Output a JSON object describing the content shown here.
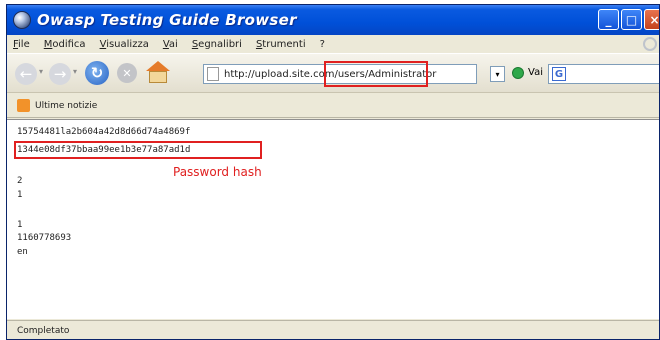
{
  "window": {
    "title": "Owasp Testing Guide Browser"
  },
  "window_buttons": {
    "minimize": "_",
    "maximize": "□",
    "close": "×"
  },
  "menu": [
    "File",
    "Modifica",
    "Visualizza",
    "Vai",
    "Segnalibri",
    "Strumenti",
    "?"
  ],
  "nav": {
    "back_glyph": "←",
    "forward_glyph": "→",
    "reload_glyph": "↻",
    "stop_glyph": "✕",
    "dropdown_glyph": "▾",
    "url": "http://upload.site.com/users/Administrator",
    "go_label": "Vai",
    "search_engine_glyph": "G"
  },
  "icons": {
    "back": "back-arrow-icon",
    "forward": "forward-arrow-icon",
    "reload": "reload-icon",
    "stop": "stop-icon",
    "home": "home-icon",
    "page": "page-icon",
    "go": "go-icon",
    "search_engine": "google-icon",
    "rss": "rss-icon",
    "app": "browser-icon"
  },
  "bookmarks": {
    "item_label": "Ultime notizie"
  },
  "content": {
    "lines": [
      "15754481la2b604a42d8d66d74a4869f",
      "1344e08df37bbaa99ee1b3e77a87ad1d",
      "2",
      "1",
      "1",
      "1160778693",
      "en"
    ],
    "annotation": "Password hash"
  },
  "status": {
    "text": "Completato"
  },
  "colors": {
    "title_bar": "#0050d8",
    "highlight": "#e02020",
    "chrome": "#ece9d8"
  }
}
